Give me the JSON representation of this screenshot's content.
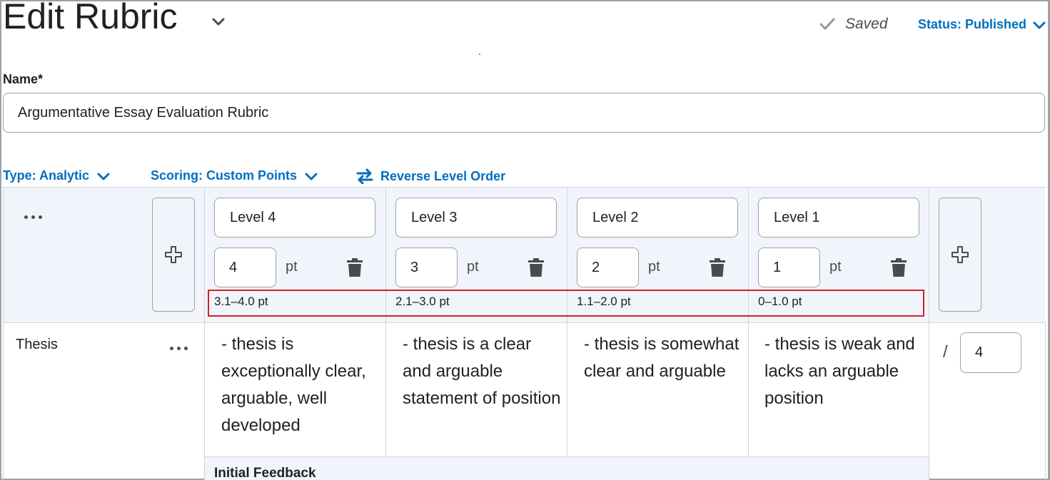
{
  "header": {
    "title": "Edit Rubric",
    "saved_label": "Saved",
    "status_label": "Status: Published"
  },
  "name_field": {
    "label": "Name*",
    "value": "Argumentative Essay Evaluation Rubric"
  },
  "options": {
    "type_label": "Type: Analytic",
    "scoring_label": "Scoring: Custom Points",
    "reverse_label": "Reverse Level Order"
  },
  "levels": [
    {
      "name": "Level 4",
      "points": "4",
      "unit": "pt",
      "range": "3.1–4.0 pt"
    },
    {
      "name": "Level 3",
      "points": "3",
      "unit": "pt",
      "range": "2.1–3.0 pt"
    },
    {
      "name": "Level 2",
      "points": "2",
      "unit": "pt",
      "range": "1.1–2.0 pt"
    },
    {
      "name": "Level 1",
      "points": "1",
      "unit": "pt",
      "range": "0–1.0 pt"
    }
  ],
  "criteria": [
    {
      "name": "Thesis",
      "descriptions": [
        "- thesis is exceptionally clear, arguable, well developed",
        "- thesis is a clear and arguable statement of position",
        "- thesis is somewhat clear and arguable",
        "- thesis is weak and lacks an arguable position"
      ],
      "score_separator": "/",
      "max_score": "4",
      "feedback_label": "Initial Feedback"
    }
  ],
  "colors": {
    "link": "#006fbf",
    "highlight_border": "#d61f25",
    "header_bg": "#f1f5fb"
  },
  "icons": {
    "title_dropdown": "chevron-down-icon",
    "saved": "check-icon",
    "add_level": "plus-icon",
    "delete_level": "trash-icon",
    "reverse": "swap-arrows-icon",
    "more_options": "ellipsis-icon"
  }
}
